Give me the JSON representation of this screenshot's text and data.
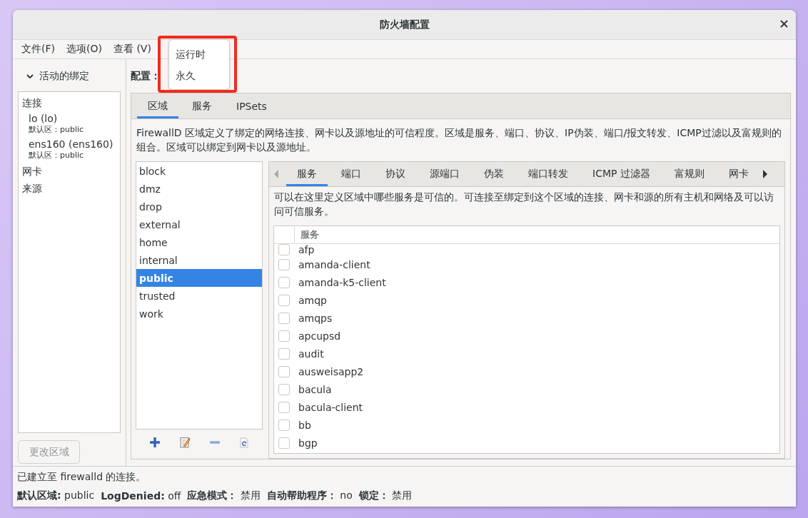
{
  "window": {
    "title": "防火墙配置"
  },
  "menu_bar": [
    {
      "label": "文件(F)"
    },
    {
      "label": "选项(O)"
    },
    {
      "label": "查看 (V)"
    }
  ],
  "popup_menu": {
    "highlighted": true,
    "items": [
      "运行时",
      "永久"
    ]
  },
  "sidebar": {
    "header": "活动的绑定",
    "expanded": true,
    "groups": [
      {
        "label": "连接",
        "children": [
          {
            "label": "lo (lo)",
            "detail": "默认区：public"
          },
          {
            "label": "ens160 (ens160)",
            "detail": "默认区：public"
          }
        ]
      },
      {
        "label": "网卡"
      },
      {
        "label": "来源"
      }
    ],
    "button": {
      "label": "更改区域",
      "disabled": true
    }
  },
  "config": {
    "label": "配置：",
    "tabs": [
      {
        "label": "区域",
        "selected": true
      },
      {
        "label": "服务",
        "selected": false
      },
      {
        "label": "IPSets",
        "selected": false
      }
    ],
    "description": "FirewallD 区域定义了绑定的网络连接、网卡以及源地址的可信程度。区域是服务、端口、协议、IP伪装、端口/报文转发、ICMP过滤以及富规则的组合。区域可以绑定到网卡以及源地址。",
    "zones": [
      {
        "label": "block",
        "selected": false
      },
      {
        "label": "dmz",
        "selected": false
      },
      {
        "label": "drop",
        "selected": false
      },
      {
        "label": "external",
        "selected": false
      },
      {
        "label": "home",
        "selected": false
      },
      {
        "label": "internal",
        "selected": false
      },
      {
        "label": "public",
        "selected": true
      },
      {
        "label": "trusted",
        "selected": false
      },
      {
        "label": "work",
        "selected": false
      }
    ],
    "zone_settings": {
      "tabs": [
        {
          "label": "服务",
          "selected": true
        },
        {
          "label": "端口",
          "selected": false
        },
        {
          "label": "协议",
          "selected": false
        },
        {
          "label": "源端口",
          "selected": false
        },
        {
          "label": "伪装",
          "selected": false
        },
        {
          "label": "端口转发",
          "selected": false
        },
        {
          "label": "ICMP 过滤器",
          "selected": false
        },
        {
          "label": "富规则",
          "selected": false
        },
        {
          "label": "网卡",
          "selected": false
        }
      ],
      "description": "可以在这里定义区域中哪些服务是可信的。可连接至绑定到这个区域的连接、网卡和源的所有主机和网络及可以访问可信服务。",
      "table": {
        "columns": [
          "服务"
        ],
        "rows": [
          {
            "label": "afp",
            "checked": false
          },
          {
            "label": "amanda-client",
            "checked": false
          },
          {
            "label": "amanda-k5-client",
            "checked": false
          },
          {
            "label": "amqp",
            "checked": false
          },
          {
            "label": "amqps",
            "checked": false
          },
          {
            "label": "apcupsd",
            "checked": false
          },
          {
            "label": "audit",
            "checked": false
          },
          {
            "label": "ausweisapp2",
            "checked": false
          },
          {
            "label": "bacula",
            "checked": false
          },
          {
            "label": "bacula-client",
            "checked": false
          },
          {
            "label": "bb",
            "checked": false
          },
          {
            "label": "bgp",
            "checked": false
          }
        ]
      }
    }
  },
  "status_bar": {
    "message": "已建立至 firewalld 的连接。",
    "fields": [
      {
        "label": "默认区域:",
        "value": "public"
      },
      {
        "label": "LogDenied:",
        "value": "off"
      },
      {
        "label": "应急模式：",
        "value": "禁用"
      },
      {
        "label": "自动帮助程序：",
        "value": "no"
      },
      {
        "label": "锁定：",
        "value": "禁用"
      }
    ]
  }
}
